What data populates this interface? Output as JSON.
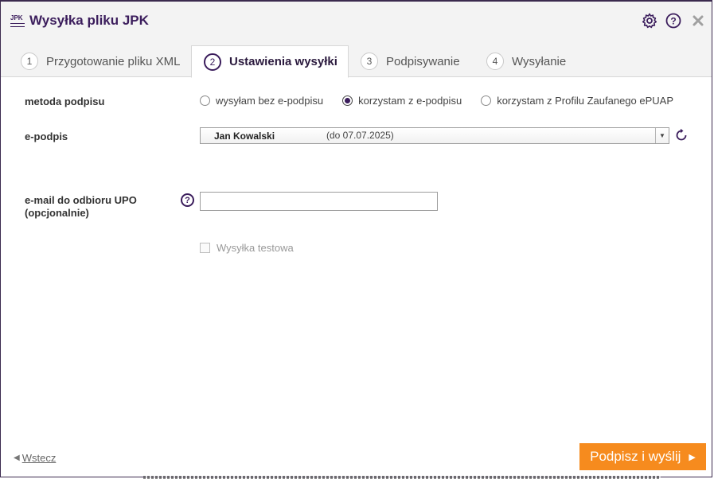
{
  "window": {
    "title": "Wysyłka pliku JPK",
    "app_icon_text": "JPK"
  },
  "tabs": [
    {
      "num": "1",
      "label": "Przygotowanie pliku XML",
      "active": false
    },
    {
      "num": "2",
      "label": "Ustawienia wysyłki",
      "active": true
    },
    {
      "num": "3",
      "label": "Podpisywanie",
      "active": false
    },
    {
      "num": "4",
      "label": "Wysyłanie",
      "active": false
    }
  ],
  "form": {
    "signature_method": {
      "label": "metoda podpisu",
      "options": [
        {
          "label": "wysyłam bez e-podpisu",
          "checked": false
        },
        {
          "label": "korzystam z e-podpisu",
          "checked": true
        },
        {
          "label": "korzystam z Profilu Zaufanego ePUAP",
          "checked": false
        }
      ]
    },
    "esignature": {
      "label": "e-podpis",
      "selected_name": "Jan Kowalski",
      "selected_validity": "(do 07.07.2025)"
    },
    "email": {
      "label_line1": "e-mail do odbioru UPO",
      "label_line2": "(opcjonalnie)",
      "help_glyph": "?",
      "value": "",
      "placeholder": ""
    },
    "test_send": {
      "label": "Wysyłka testowa",
      "checked": false,
      "disabled": true
    }
  },
  "footer": {
    "back_label": "Wstecz",
    "submit_label": "Podpisz i wyślij"
  },
  "colors": {
    "accent": "#3b1d5c",
    "primary_button": "#f68b1e"
  },
  "icons": {
    "settings": "gear-icon",
    "help": "help-icon",
    "close": "close-icon",
    "refresh": "refresh-icon"
  }
}
